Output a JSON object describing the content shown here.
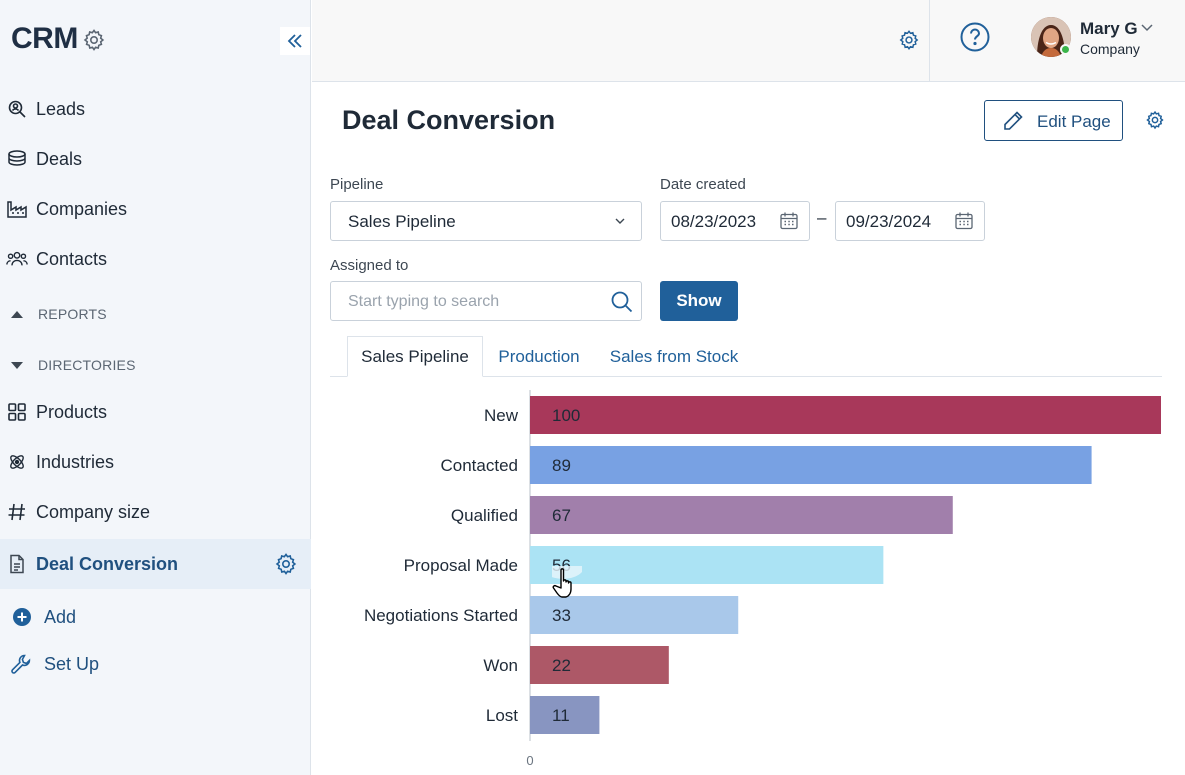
{
  "sidebar": {
    "brand": "CRM",
    "items": [
      {
        "label": "Leads",
        "icon": "search-person-icon"
      },
      {
        "label": "Deals",
        "icon": "coins-icon"
      },
      {
        "label": "Companies",
        "icon": "factory-icon"
      },
      {
        "label": "Contacts",
        "icon": "people-icon"
      }
    ],
    "sections": [
      {
        "label": "REPORTS",
        "icon": "triangle-up-icon"
      },
      {
        "label": "DIRECTORIES",
        "icon": "triangle-down-icon"
      }
    ],
    "directory_items": [
      {
        "label": "Products",
        "icon": "grid-icon"
      },
      {
        "label": "Industries",
        "icon": "atom-icon"
      },
      {
        "label": "Company size",
        "icon": "hash-icon"
      }
    ],
    "active_item": {
      "label": "Deal Conversion",
      "icon": "document-icon"
    },
    "actions": [
      {
        "label": "Add",
        "icon": "plus-circle-icon"
      },
      {
        "label": "Set Up",
        "icon": "wrench-icon"
      }
    ]
  },
  "header": {
    "user_name": "Mary G",
    "user_company": "Company"
  },
  "page": {
    "title": "Deal Conversion",
    "edit_button": "Edit Page"
  },
  "filters": {
    "pipeline_label": "Pipeline",
    "pipeline_value": "Sales Pipeline",
    "date_label": "Date created",
    "date_from": "08/23/2023",
    "date_separator": "–",
    "date_to": "09/23/2024",
    "assigned_label": "Assigned to",
    "assigned_placeholder": "Start typing to search",
    "show_button": "Show"
  },
  "tabs": [
    {
      "label": "Sales Pipeline",
      "active": true
    },
    {
      "label": "Production",
      "active": false
    },
    {
      "label": "Sales from Stock",
      "active": false
    }
  ],
  "chart_data": {
    "type": "bar",
    "orientation": "horizontal",
    "categories": [
      "New",
      "Contacted",
      "Qualified",
      "Proposal Made",
      "Negotiations Started",
      "Won",
      "Lost"
    ],
    "values": [
      100,
      89,
      67,
      56,
      33,
      22,
      11
    ],
    "colors": [
      "#a8385a",
      "#78a1e3",
      "#a17fab",
      "#abe3f4",
      "#a9c8ea",
      "#ad5867",
      "#8895c1"
    ],
    "xlim": [
      0,
      100
    ],
    "x_ticks": [
      "0"
    ],
    "grid": false,
    "legend": false
  }
}
